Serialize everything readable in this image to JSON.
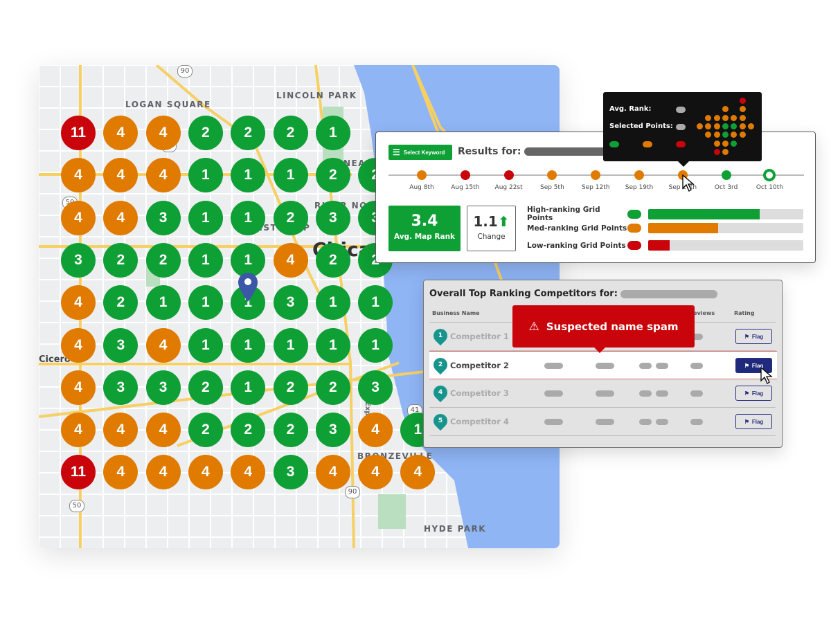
{
  "colors": {
    "high": "#0e9f35",
    "med": "#e07b00",
    "low": "#c9050b",
    "lake": "#8fb5f5",
    "flag": "#1f2a7c",
    "teal": "#17958d"
  },
  "map": {
    "labels": {
      "logan": "LOGAN SQUARE",
      "lincoln": "LINCOLN PARK",
      "near": "NEAR",
      "river_north": "RIVER NORTH",
      "west": "WEST LOOP",
      "city": "Chicago",
      "cicero": "Cicero",
      "bronzeville": "BRONZEVILLE",
      "hyde": "HYDE PARK",
      "express": "I-90 Express"
    },
    "shields": [
      "90",
      "94",
      "50",
      "41",
      "90",
      "50"
    ],
    "grid": [
      [
        11,
        4,
        4,
        2,
        2,
        2,
        1,
        null,
        null
      ],
      [
        4,
        4,
        4,
        1,
        1,
        1,
        2,
        2,
        null
      ],
      [
        4,
        4,
        3,
        1,
        1,
        2,
        3,
        3,
        null
      ],
      [
        3,
        2,
        2,
        1,
        1,
        4,
        2,
        2,
        null
      ],
      [
        4,
        2,
        1,
        1,
        1,
        3,
        1,
        1,
        null
      ],
      [
        4,
        3,
        4,
        1,
        1,
        1,
        1,
        1,
        null
      ],
      [
        4,
        3,
        3,
        2,
        1,
        2,
        2,
        3,
        null
      ],
      [
        4,
        4,
        4,
        2,
        2,
        2,
        3,
        4,
        1
      ],
      [
        11,
        4,
        4,
        4,
        4,
        3,
        4,
        4,
        4
      ]
    ]
  },
  "results": {
    "select_keyword": "Select Keyword",
    "results_for": "Results for:",
    "timeline": [
      {
        "label": "Aug 8th",
        "status": "med"
      },
      {
        "label": "Aug 15th",
        "status": "low"
      },
      {
        "label": "Aug 22st",
        "status": "low"
      },
      {
        "label": "Sep 5th",
        "status": "med"
      },
      {
        "label": "Sep 12th",
        "status": "med"
      },
      {
        "label": "Sep 19th",
        "status": "med"
      },
      {
        "label": "Sep 26th",
        "status": "med"
      },
      {
        "label": "Oct 3rd",
        "status": "high"
      },
      {
        "label": "Oct 10th",
        "status": "selected"
      }
    ],
    "avg_value": "3.4",
    "avg_label": "Avg. Map Rank",
    "change_value": "1.1",
    "change_label": "Change",
    "bars": [
      {
        "label": "High-ranking Grid Points",
        "status": "high",
        "percent": 72
      },
      {
        "label": "Med-ranking Grid Points",
        "status": "med",
        "percent": 45
      },
      {
        "label": "Low-ranking Grid Points",
        "status": "low",
        "percent": 14
      }
    ]
  },
  "tooltip": {
    "avg_rank": "Avg. Rank:",
    "selected_points": "Selected Points:",
    "mini_grid": [
      "-----r-",
      "---o-o-",
      "-ooooo-",
      "oooggoo",
      "-oogoo-",
      "--oog--",
      "--ro---"
    ]
  },
  "competitors": {
    "title": "Overall Top Ranking Competitors for:",
    "headers": {
      "name": "Business Name",
      "reviews": "Reviews",
      "rating": "Rating"
    },
    "rows": [
      {
        "rank": "1",
        "name": "Competitor 1",
        "selected": false
      },
      {
        "rank": "2",
        "name": "Competitor 2",
        "selected": true
      },
      {
        "rank": "4",
        "name": "Competitor 3",
        "selected": false
      },
      {
        "rank": "5",
        "name": "Competitor 4",
        "selected": false
      }
    ],
    "flag_label": "Flag",
    "spam_warning": "Suspected name spam"
  }
}
